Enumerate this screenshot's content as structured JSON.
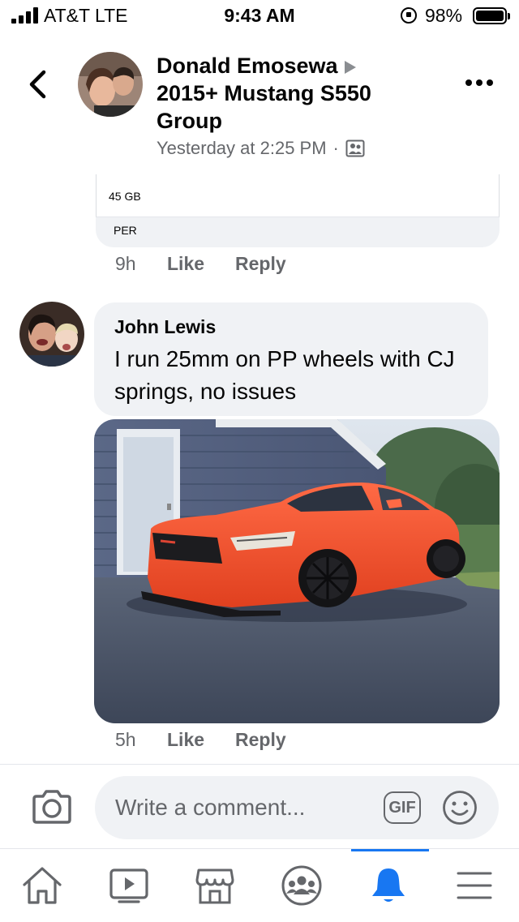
{
  "status_bar": {
    "carrier": "AT&T  LTE",
    "time": "9:43 AM",
    "battery": "98%"
  },
  "header": {
    "title": "Donald Emosewa",
    "group": "2015+ Mustang S550 Group",
    "timestamp": "Yesterday at 2:25 PM",
    "separator": "·",
    "audience_icon": "group-audience-icon"
  },
  "prev_comment": {
    "card_line1": "45 GB",
    "card_line2": "PER",
    "time": "9h",
    "like": "Like",
    "reply": "Reply"
  },
  "comment": {
    "author": "John Lewis",
    "text": "I run 25mm on PP wheels with CJ springs, no issues",
    "time": "5h",
    "like": "Like",
    "reply": "Reply"
  },
  "composer": {
    "placeholder": "Write a comment...",
    "gif": "GIF"
  },
  "tabs": [
    "home-icon",
    "video-icon",
    "marketplace-icon",
    "groups-icon",
    "notifications-icon",
    "menu-icon"
  ],
  "colors": {
    "accent": "#1877f2",
    "secondary_text": "#65676b",
    "bubble_bg": "#f0f2f5",
    "car": "#ff5a36"
  }
}
